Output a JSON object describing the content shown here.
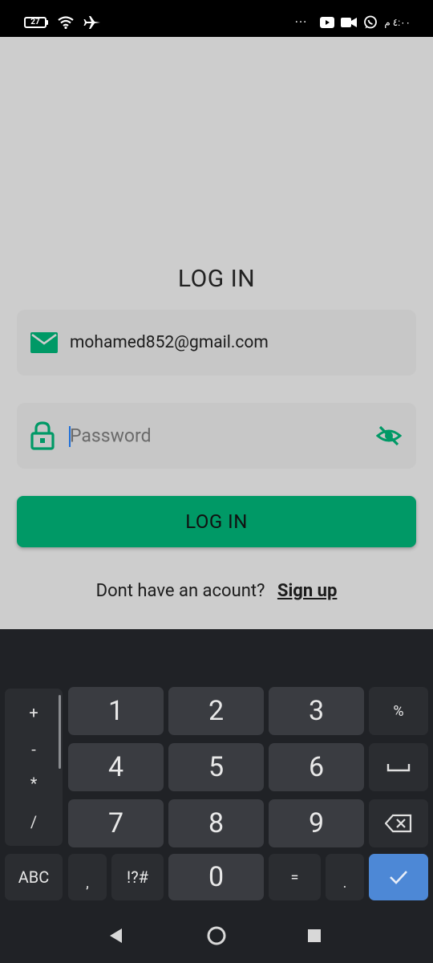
{
  "status_bar": {
    "battery": "27",
    "time": "٤:٠٠ م",
    "more": "···"
  },
  "login": {
    "title": "LOG IN",
    "email_value": "mohamed852@gmail.com",
    "password_placeholder": "Password",
    "button_label": "LOG IN",
    "signup_prompt": "Dont have an acount?",
    "signup_link": "Sign up"
  },
  "keyboard": {
    "side_symbols": [
      "+",
      "-",
      "*",
      "/"
    ],
    "digits": [
      "1",
      "2",
      "3",
      "4",
      "5",
      "6",
      "7",
      "8",
      "9",
      "0"
    ],
    "percent": "%",
    "abc": "ABC",
    "comma": ",",
    "symbols": "!?#",
    "equals": "=",
    "period": "."
  },
  "colors": {
    "accent": "#009966",
    "background": "#cdcdcd",
    "keyboard": "#202226",
    "enter": "#4d88d6"
  }
}
